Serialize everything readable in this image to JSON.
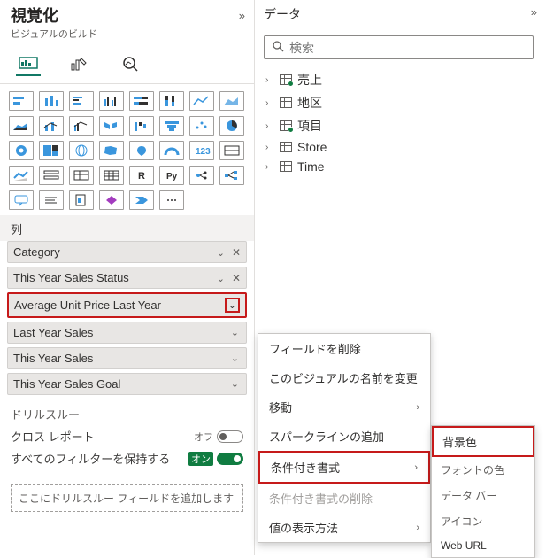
{
  "viz": {
    "title": "視覚化",
    "subtitle": "ビジュアルのビルド",
    "collapse": "»",
    "section_columns": "列",
    "fields": [
      {
        "label": "Category",
        "removable": true
      },
      {
        "label": "This Year Sales Status",
        "removable": true
      },
      {
        "label": "Average Unit Price Last Year",
        "removable": false,
        "highlighted": true
      },
      {
        "label": "Last Year Sales",
        "removable": false
      },
      {
        "label": "This Year Sales",
        "removable": false
      },
      {
        "label": "This Year Sales Goal",
        "removable": false
      }
    ],
    "drill_label": "ドリルスルー",
    "cross_report": "クロス レポート",
    "keep_filters": "すべてのフィルターを保持する",
    "toggle_on_label": "オン",
    "toggle_off_label": "オフ",
    "drop_hint": "ここにドリルスルー フィールドを追加します"
  },
  "data": {
    "title": "データ",
    "collapse": "»",
    "search_placeholder": "検索",
    "tables": [
      {
        "name": "売上",
        "checked": true
      },
      {
        "name": "地区",
        "checked": false
      },
      {
        "name": "項目",
        "checked": true
      },
      {
        "name": "Store",
        "checked": false
      },
      {
        "name": "Time",
        "checked": false
      }
    ]
  },
  "ctx1": {
    "remove": "フィールドを削除",
    "rename": "このビジュアルの名前を変更",
    "move": "移動",
    "sparkline": "スパークラインの追加",
    "cond_format": "条件付き書式",
    "cond_format_remove": "条件付き書式の削除",
    "show_value": "値の表示方法"
  },
  "ctx2": {
    "bg": "背景色",
    "font": "フォントの色",
    "databar": "データ バー",
    "icon": "アイコン",
    "weburl": "Web URL"
  }
}
